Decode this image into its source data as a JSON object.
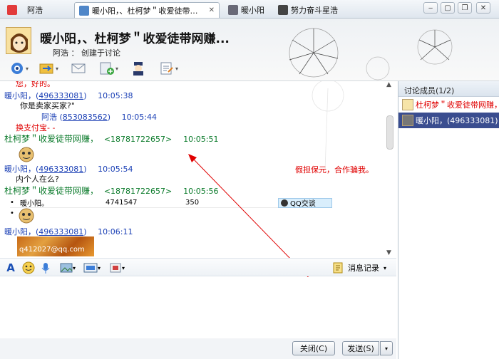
{
  "tabs": [
    {
      "label": "阿浩"
    },
    {
      "label": "暖小阳，、杜柯梦＂收爱徒带网赚..."
    },
    {
      "label": "暖小阳"
    },
    {
      "label": "努力奋斗星浩"
    }
  ],
  "header": {
    "title": "暖小阳，、杜柯梦＂收爱徒带网赚...",
    "subtitle": "阿浩 ： 创建于讨论"
  },
  "toolbar": {
    "icons": [
      "camera-icon",
      "file-transfer-icon",
      "mail-icon",
      "add-contact-icon",
      "police-icon",
      "notes-icon"
    ]
  },
  "chat": {
    "top_partial": "您，好的。",
    "messages": [
      {
        "sender": "暖小阳，",
        "open": "(",
        "qq": "496333081",
        "close": ")",
        "time": "10:05:38",
        "body": "你是卖家买家?\""
      },
      {
        "sender": "阿浩",
        "open": "(",
        "qq": "853083562",
        "close": ")",
        "time": "10:05:44",
        "body": "换支付宝- -"
      },
      {
        "sender": "杜柯梦＂收爱徒带网赚，",
        "qq_plain": "<18781722657>",
        "time": "10:05:51"
      },
      {
        "sender": "暖小阳，",
        "open": "(",
        "qq": "496333081",
        "close": ")",
        "time": "10:05:54",
        "body": "内个人在么?"
      },
      {
        "sender": "杜柯梦＂收爱徒带网赚，",
        "qq_plain": "<18781722657>",
        "time": "10:05:56"
      },
      {
        "sender": "暖小阳，",
        "open": "(",
        "qq": "496333081",
        "close": ")",
        "time": "10:06:11"
      }
    ],
    "table_row": {
      "name": "暖小阳。",
      "num": "4741547",
      "val": "350",
      "btn": "QQ交谈"
    },
    "image_caption": "q412027@qq.com",
    "annotation": "假担保元，合作骗我。"
  },
  "formatbar": {
    "history_label": "消息记录"
  },
  "buttons": {
    "close": "关闭(C)",
    "send": "发送(S)"
  },
  "sidebar": {
    "header": "讨论成员(1/2)",
    "members": [
      {
        "name": "杜柯梦＂收爱徒带网赚，",
        "color": "#e00000"
      },
      {
        "name": "暖小阳，(496333081)",
        "color": "#ffffff"
      }
    ]
  },
  "colors": {
    "accent_blue": "#1a3fb5",
    "green": "#0a7a2a",
    "red": "#e00000",
    "selected": "#3a4d8f"
  }
}
